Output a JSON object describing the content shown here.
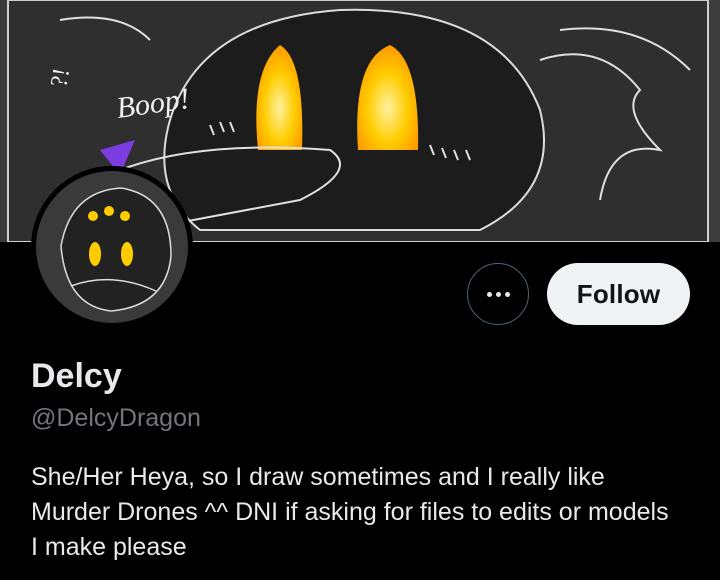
{
  "profile": {
    "banner_text": "Boop!",
    "banner_scribble": "?!",
    "display_name": "Delcy",
    "handle": "@DelcyDragon",
    "bio": "She/Her Heya, so I draw sometimes and I really like Murder Drones ^^ DNI if asking for files to edits or models I make please"
  },
  "actions": {
    "more_icon": "more-horizontal-icon",
    "follow_label": "Follow"
  },
  "colors": {
    "background": "#000000",
    "eye_glow": "#ffcc00",
    "follow_bg": "#eff3f4",
    "secondary_text": "#71767b"
  }
}
